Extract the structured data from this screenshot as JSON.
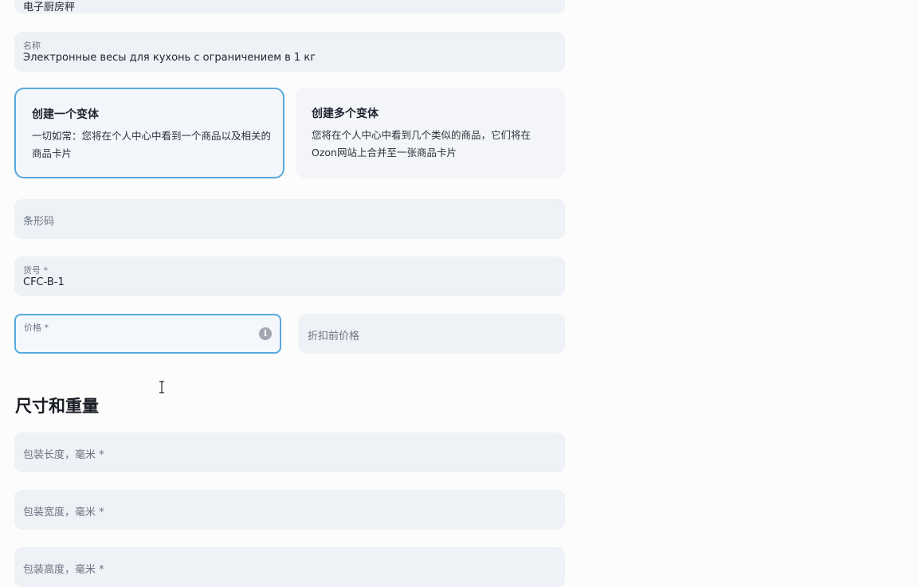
{
  "fields": {
    "category_value": "电子厨房秤",
    "name_label": "名称",
    "name_value": "Электронные весы для кухонь с ограничением в 1 кг",
    "barcode_placeholder": "条形码",
    "sku_label": "货号 *",
    "sku_value": "CFC-B-1",
    "price_label": "价格 *",
    "price_value": "",
    "discount_price_placeholder": "折扣前价格"
  },
  "variants": {
    "single": {
      "title": "创建一个变体",
      "desc": "一切如常：您将在个人中心中看到一个商品以及相关的商品卡片",
      "selected": true
    },
    "multiple": {
      "title": "创建多个变体",
      "desc": "您将在个人中心中看到几个类似的商品，它们将在Ozon网站上合并至一张商品卡片",
      "selected": false
    }
  },
  "dimensions": {
    "section_title": "尺寸和重量",
    "length_placeholder": "包装长度，毫米 *",
    "width_placeholder": "包装宽度，毫米 *",
    "height_placeholder": "包装高度，毫米 *"
  },
  "colors": {
    "accent": "#58a9dc",
    "field_bg": "#eef1f5"
  },
  "icons": {
    "price_info": "info-icon"
  }
}
